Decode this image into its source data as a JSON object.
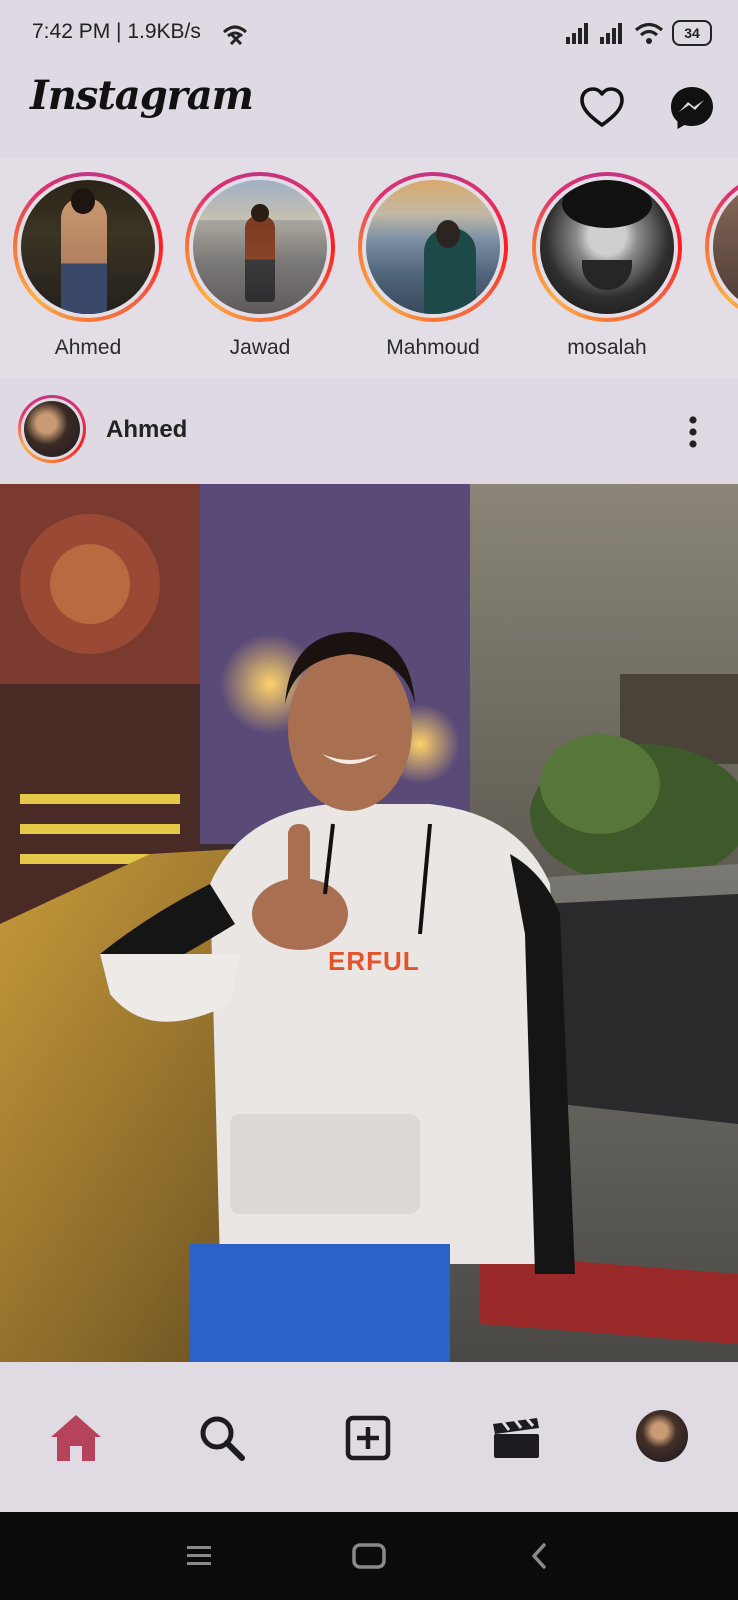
{
  "status_bar": {
    "time": "7:42 PM | 1.9KB/s",
    "battery": "34"
  },
  "header": {
    "logo": "Instagram",
    "icons": [
      "heart-icon",
      "messenger-icon"
    ]
  },
  "stories": [
    {
      "label": "Ahmed"
    },
    {
      "label": "Jawad"
    },
    {
      "label": "Mahmoud"
    },
    {
      "label": "mosalah"
    }
  ],
  "post": {
    "username": "Ahmed",
    "hoodie_text": "ERFUL"
  },
  "bottom_nav": {
    "items": [
      "home-icon",
      "search-icon",
      "add-post-icon",
      "reels-icon",
      "profile-avatar"
    ],
    "active": "home-icon",
    "accent_color": "#b5435b"
  },
  "system_nav": {
    "items": [
      "menu-icon",
      "home-square-icon",
      "back-icon"
    ]
  }
}
